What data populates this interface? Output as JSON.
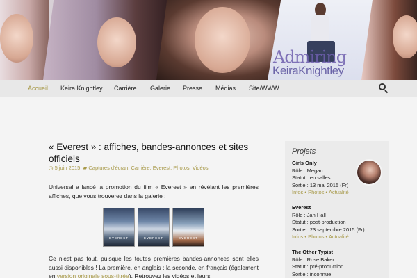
{
  "banner": {
    "title": "Admiring",
    "subtitle": "KeiraKnightley"
  },
  "nav": {
    "items": [
      "Accueil",
      "Keira Knightley",
      "Carrière",
      "Galerie",
      "Presse",
      "Médias",
      "Site/WWW"
    ],
    "active": "Accueil"
  },
  "post": {
    "title": "« Everest » : affiches, bandes-annonces et sites officiels",
    "date": "5 juin 2015",
    "categories": "Captures d'écran, Carrière, Everest, Photos, Vidéos",
    "p1": "Universal a lancé la promotion du film « Everest » en révélant les premières affiches, que vous trouverez dans la galerie :",
    "poster_word": "EVEREST",
    "p2_a": "Ce n'est pas tout, puisque les toutes premières bandes-annonces sont elles aussi disponibles ! La première, en anglais ; la seconde, en français (également en ",
    "p2_link": "version originale sous-titrée",
    "p2_b": "). Retrouvez les vidéos et leurs"
  },
  "sidebar": {
    "heading": "Projets",
    "projects": [
      {
        "title": "Girls Only",
        "role": "Rôle : Megan",
        "status": "Statut : en salles",
        "release": "Sortie : 13 mai 2015 (Fr)",
        "links": [
          "Infos",
          "Photos",
          "Actualité"
        ]
      },
      {
        "title": "Everest",
        "role": "Rôle : Jan Hall",
        "status": "Statut : post-production",
        "release": "Sortie : 23 septembre 2015 (Fr)",
        "links": [
          "Infos",
          "Photos",
          "Actualité"
        ]
      },
      {
        "title": "The Other Typist",
        "role": "Rôle : Rose Baker",
        "status": "Statut : pré-production",
        "release": "Sortie : inconnue",
        "links": []
      }
    ]
  },
  "colors": {
    "accent": "#a89a4a",
    "nav_bg": "#e8e8e8",
    "page_bg": "#f4f4f4",
    "sidebar_bg": "#ebebeb"
  },
  "icons": {
    "search": "search-icon",
    "date": "clock-icon",
    "category": "folder-icon"
  }
}
